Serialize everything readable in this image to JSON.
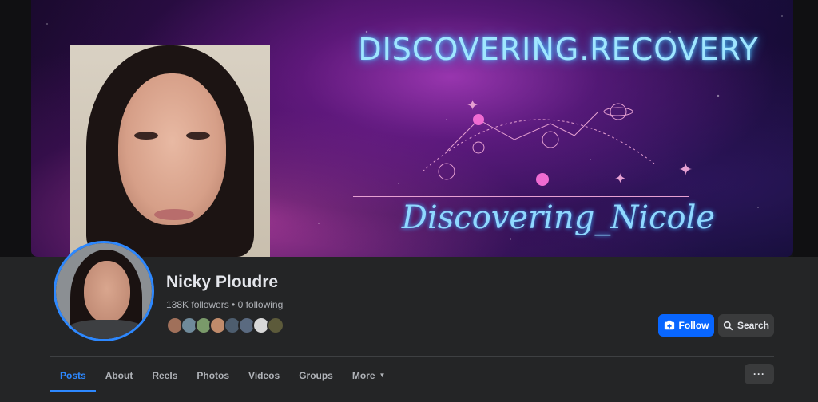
{
  "cover": {
    "title": "DISCOVERING.RECOVERY",
    "signature": "Discovering_Nicole"
  },
  "profile": {
    "name": "Nicky Ploudre",
    "stats": "138K followers • 0 following",
    "friend_colors": [
      "#a0705a",
      "#6f8a9a",
      "#7a9a6a",
      "#c08b6b",
      "#4d5d6e",
      "#5a6a80",
      "#d8d8d8",
      "#5c5a3a"
    ]
  },
  "actions": {
    "follow_label": "Follow",
    "search_label": "Search"
  },
  "tabs": {
    "items": [
      {
        "label": "Posts"
      },
      {
        "label": "About"
      },
      {
        "label": "Reels"
      },
      {
        "label": "Photos"
      },
      {
        "label": "Videos"
      },
      {
        "label": "Groups"
      },
      {
        "label": "More"
      }
    ],
    "more_menu_label": "···"
  },
  "colors": {
    "accent": "#2d88ff",
    "follow_button": "#0866ff",
    "background": "#242526"
  }
}
